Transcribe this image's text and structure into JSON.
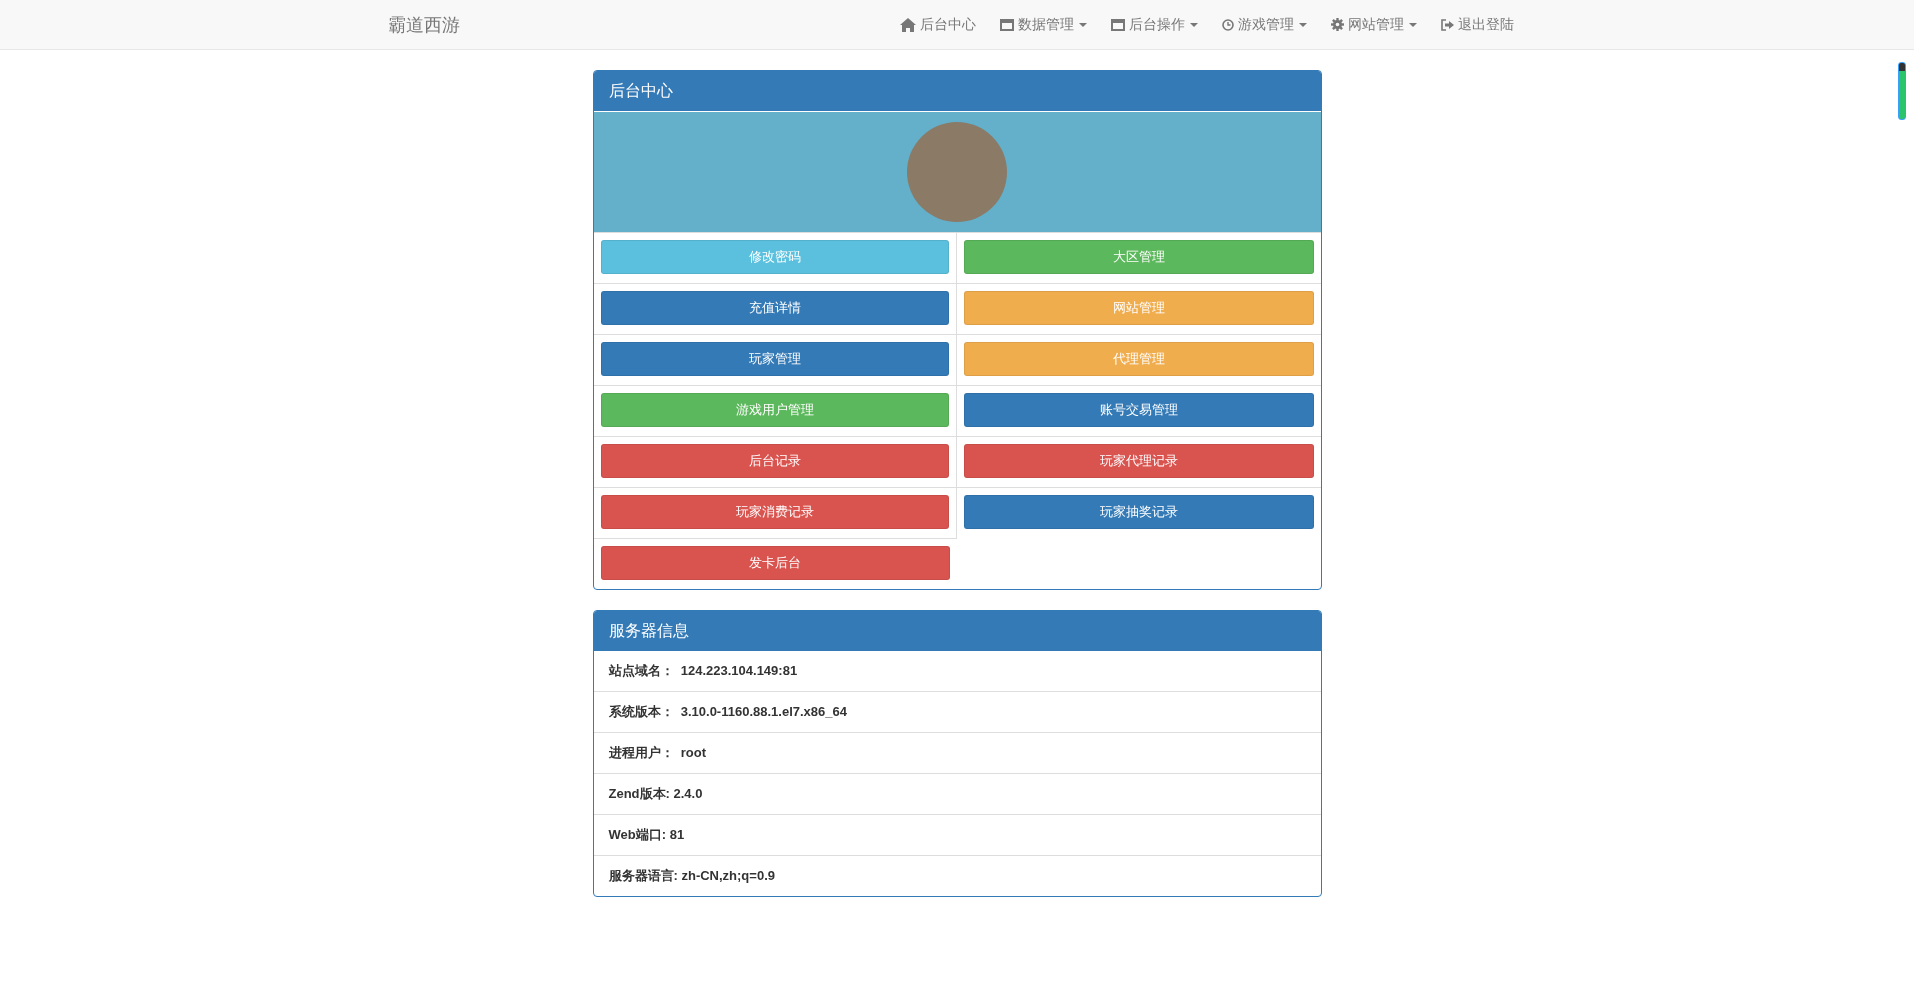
{
  "navbar": {
    "brand": "霸道西游",
    "items": [
      {
        "label": "后台中心",
        "dropdown": false
      },
      {
        "label": "数据管理",
        "dropdown": true
      },
      {
        "label": "后台操作",
        "dropdown": true
      },
      {
        "label": "游戏管理",
        "dropdown": true
      },
      {
        "label": "网站管理",
        "dropdown": true
      },
      {
        "label": "退出登陆",
        "dropdown": false
      }
    ]
  },
  "admin_panel": {
    "title": "后台中心",
    "buttons": [
      {
        "label": "修改密码",
        "color": "#5bc0de"
      },
      {
        "label": "大区管理",
        "color": "#5cb85c"
      },
      {
        "label": "充值详情",
        "color": "#337ab7"
      },
      {
        "label": "网站管理",
        "color": "#f0ad4e"
      },
      {
        "label": "玩家管理",
        "color": "#337ab7"
      },
      {
        "label": "代理管理",
        "color": "#f0ad4e"
      },
      {
        "label": "游戏用户管理",
        "color": "#5cb85c"
      },
      {
        "label": "账号交易管理",
        "color": "#337ab7"
      },
      {
        "label": "后台记录",
        "color": "#d9534f"
      },
      {
        "label": "玩家代理记录",
        "color": "#d9534f"
      },
      {
        "label": "玩家消费记录",
        "color": "#d9534f"
      },
      {
        "label": "玩家抽奖记录",
        "color": "#337ab7"
      },
      {
        "label": "发卡后台",
        "color": "#d9534f"
      }
    ]
  },
  "server_panel": {
    "title": "服务器信息",
    "rows": [
      "站点域名：  124.223.104.149:81",
      "系统版本：  3.10.0-1160.88.1.el7.x86_64",
      "进程用户：  root",
      "Zend版本: 2.4.0",
      "Web端口: 81",
      "服务器语言: zh-CN,zh;q=0.9"
    ]
  }
}
